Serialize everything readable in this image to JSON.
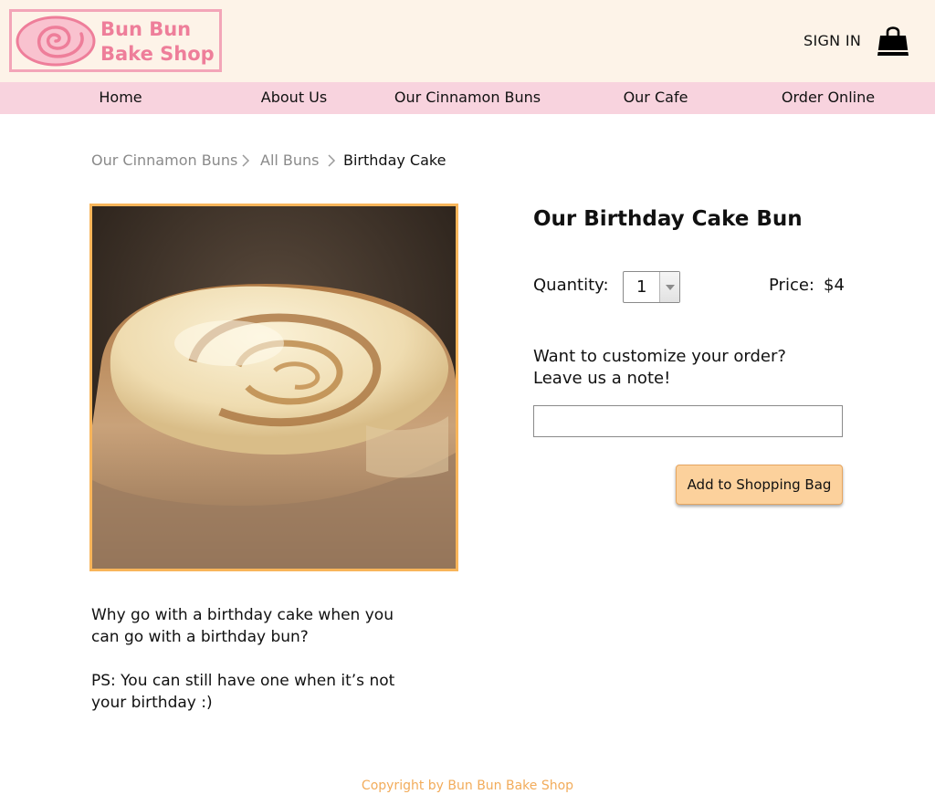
{
  "header": {
    "logo_line1": "Bun Bun",
    "logo_line2": "Bake Shop",
    "sign_in": "SIGN IN",
    "bag_icon": "shopping-bag-icon"
  },
  "nav": {
    "items": [
      {
        "label": "Home"
      },
      {
        "label": "About Us"
      },
      {
        "label": "Our Cinnamon Buns"
      },
      {
        "label": "Our Cafe"
      },
      {
        "label": "Order Online"
      }
    ]
  },
  "breadcrumb": {
    "items": [
      "Our Cinnamon Buns",
      "All Buns",
      "Birthday Cake"
    ]
  },
  "product": {
    "title": "Our Birthday Cake Bun",
    "quantity_label": "Quantity:",
    "quantity_value": "1",
    "price_label": "Price:",
    "price_value": "$4",
    "note_line1": "Want to customize your order?",
    "note_line2": "Leave us a note!",
    "note_value": "",
    "add_button": "Add to Shopping Bag",
    "description_p1_line1": "Why go with a birthday cake when you",
    "description_p1_line2": "can go with a birthday bun?",
    "description_p2_line1": "PS: You can still have one when it’s not",
    "description_p2_line2": "your birthday :)"
  },
  "footer": {
    "copyright": "Copyright by Bun Bun Bake Shop"
  },
  "colors": {
    "header_bg": "#fdf3e8",
    "nav_bg": "#f8d3de",
    "logo_pink": "#ee7e9a",
    "accent_orange": "#f8b55a",
    "button_bg": "#fcd19c",
    "footer_text": "#f2ac5b"
  }
}
